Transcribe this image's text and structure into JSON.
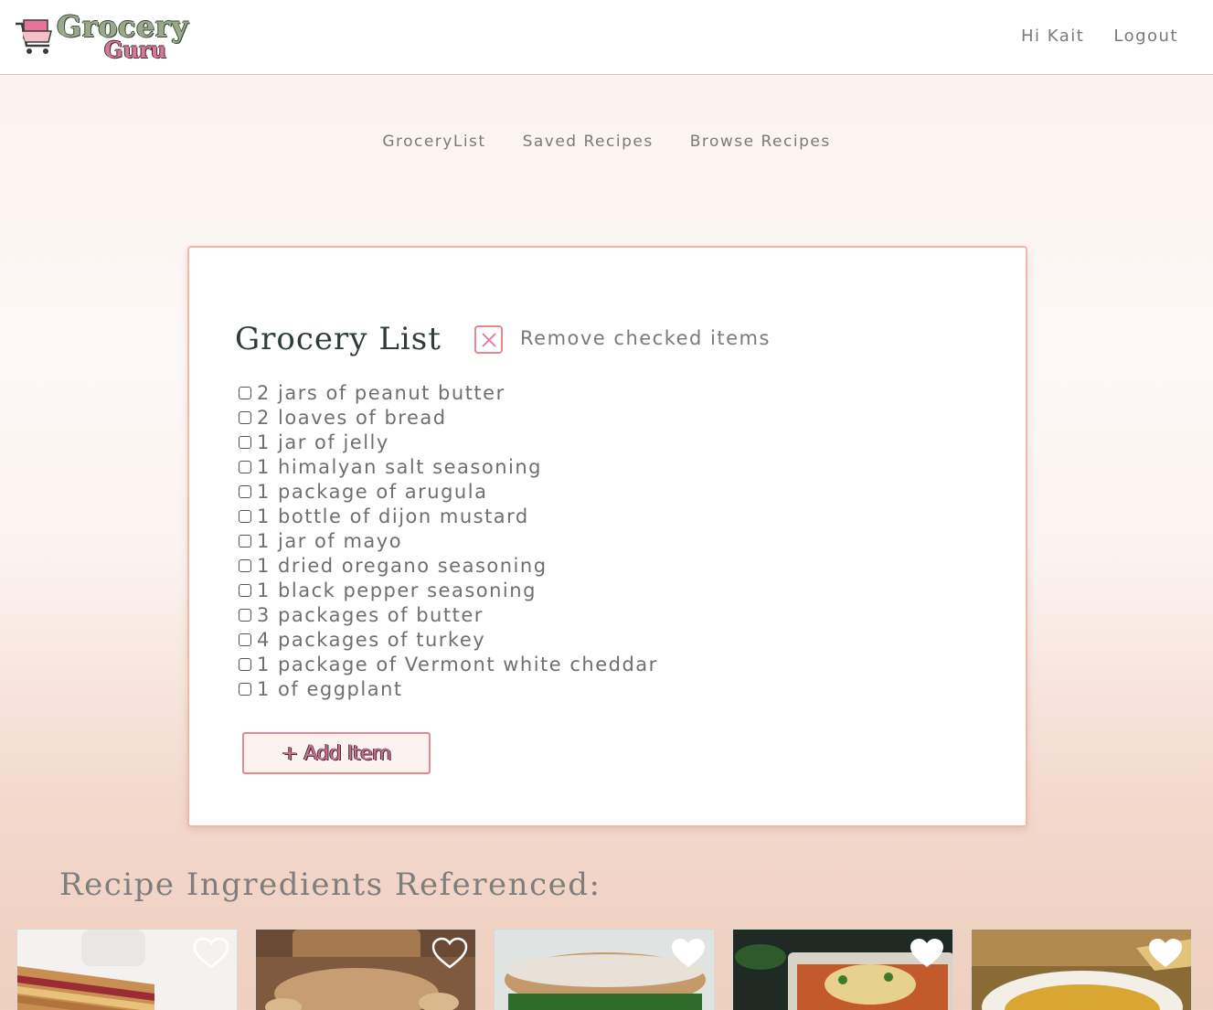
{
  "header": {
    "logo_top": "Grocery",
    "logo_bottom": "Guru",
    "greeting": "Hi Kait",
    "logout": "Logout"
  },
  "subnav": {
    "items": [
      {
        "label": "GroceryList"
      },
      {
        "label": "Saved Recipes"
      },
      {
        "label": "Browse Recipes"
      }
    ]
  },
  "grocery_list": {
    "title": "Grocery List",
    "remove_checked_label": "Remove checked items",
    "items": [
      {
        "text": "2 jars of peanut butter",
        "checked": false
      },
      {
        "text": "2 loaves of bread",
        "checked": false
      },
      {
        "text": "1 jar of jelly",
        "checked": false
      },
      {
        "text": "1 himalyan salt seasoning",
        "checked": false
      },
      {
        "text": "1 package of arugula",
        "checked": false
      },
      {
        "text": "1 bottle of dijon mustard",
        "checked": false
      },
      {
        "text": "1 jar of mayo",
        "checked": false
      },
      {
        "text": "1 dried oregano seasoning",
        "checked": false
      },
      {
        "text": "1 black pepper seasoning",
        "checked": false
      },
      {
        "text": "3 packages of butter",
        "checked": false
      },
      {
        "text": "4 packages of turkey",
        "checked": false
      },
      {
        "text": "1 package of Vermont white cheddar",
        "checked": false
      },
      {
        "text": "1 of eggplant",
        "checked": false
      }
    ],
    "add_item_label": "+ Add Item"
  },
  "recipes_section": {
    "title": "Recipe Ingredients Referenced:",
    "recipes": [
      {
        "image": "pbj-grilled-sandwich",
        "favorited": false
      },
      {
        "image": "peanut-butter-toast",
        "favorited": false
      },
      {
        "image": "turkey-ciabatta-sandwich",
        "favorited": true
      },
      {
        "image": "eggplant-parmesan",
        "favorited": true
      },
      {
        "image": "pasta-bowl",
        "favorited": true
      }
    ]
  },
  "colors": {
    "accent_pink": "#e8888c",
    "title_green": "#2f3e35",
    "card_border": "#efb9a6"
  }
}
